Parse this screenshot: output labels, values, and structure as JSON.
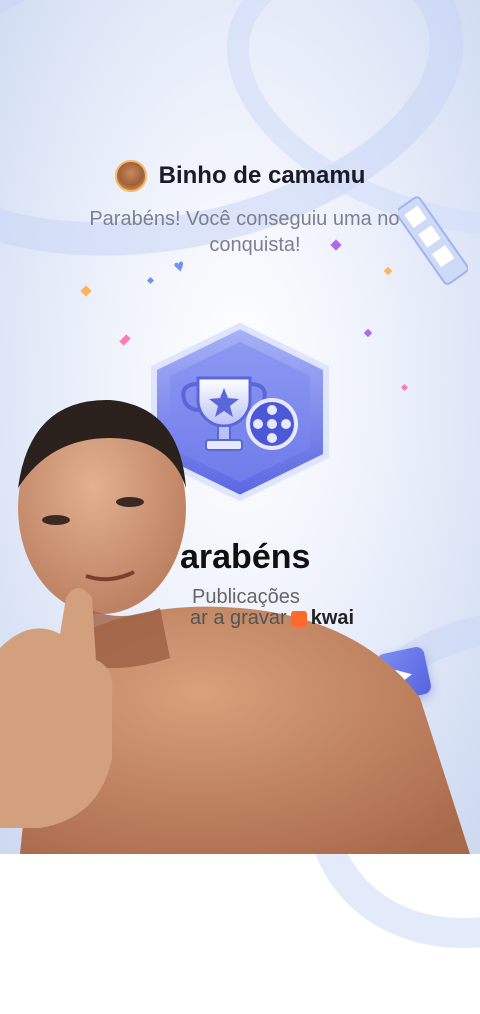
{
  "header": {
    "username": "Binho de camamu",
    "subtitle": "Parabéns! Você conseguiu uma nova conquista!"
  },
  "overlay": {
    "congrats": "arabéns",
    "publicacoes": "Publicações",
    "gravar": "ar a gravar",
    "brand": "kwai"
  },
  "colors": {
    "accent": "#5563e0",
    "badge": "#6b78ea",
    "confetti_pink": "#ff7ab6",
    "confetti_purple": "#b06af0",
    "confetti_orange": "#ffb35a"
  },
  "icons": [
    "trophy-icon",
    "film-reel-icon",
    "star-icon",
    "play-icon",
    "film-strip-icon",
    "heart-icon"
  ]
}
